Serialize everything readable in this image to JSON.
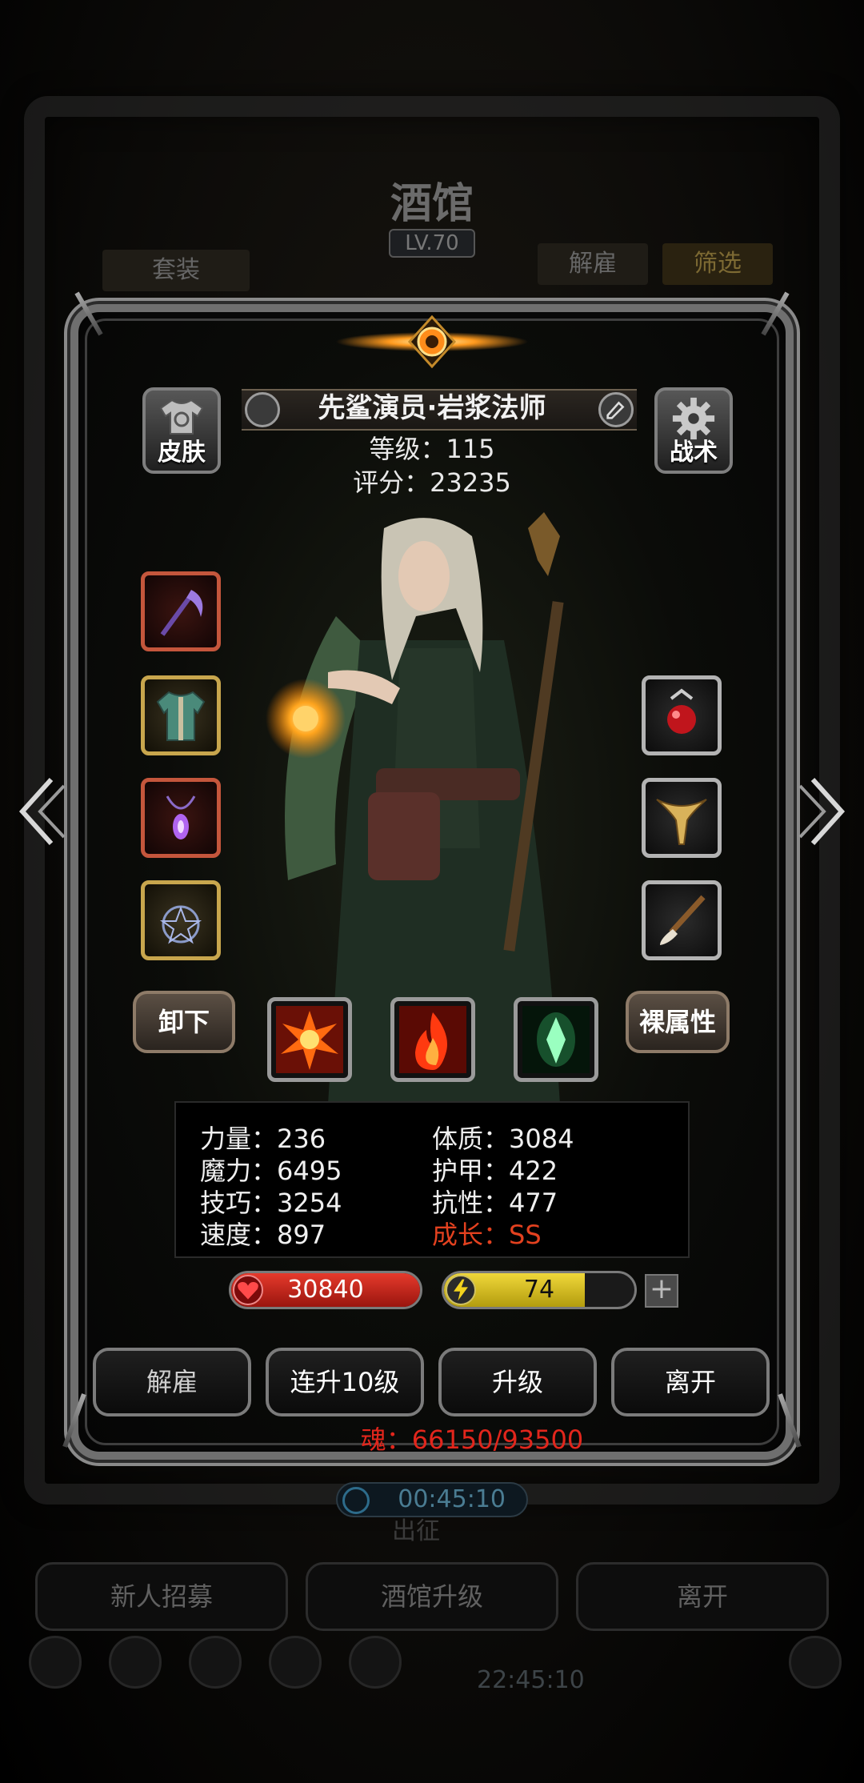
{
  "background": {
    "title": "酒馆",
    "level": "LV.70",
    "tab_suit": "套装",
    "tab_dismiss": "解雇",
    "tab_filter": "筛选",
    "timer": "00:45:10",
    "expedition_label": "出征",
    "bottom_buttons": [
      "新人招募",
      "酒馆升级",
      "离开"
    ],
    "clock": "22:45:10"
  },
  "hero": {
    "name": "先鲨演员·岩浆法师",
    "level_label": "等级：115",
    "score_label": "评分：23235",
    "skin_button": "皮肤",
    "tactics_button": "战术",
    "unequip_button": "卸下",
    "base_attr_button": "裸属性",
    "equipment_left": [
      "scythe-icon",
      "robe-icon",
      "amulet-icon",
      "pentagram-amulet-icon"
    ],
    "equipment_right": [
      "ruby-ring-icon",
      "horn-ring-icon",
      "brush-icon"
    ],
    "skills": [
      "fire-burst-skill-icon",
      "flame-skill-icon",
      "green-crystal-skill-icon"
    ]
  },
  "stats": {
    "strength": "力量：236",
    "constitution": "体质：3084",
    "magic": "魔力：6495",
    "armor": "护甲：422",
    "skill": "技巧：3254",
    "resistance": "抗性：477",
    "speed": "速度：897",
    "growth": "成长：SS"
  },
  "bars": {
    "hp": "30840",
    "energy": "74",
    "energy_fraction": 0.74
  },
  "actions": {
    "dismiss": "解雇",
    "upgrade10": "连升10级",
    "upgrade": "升级",
    "leave": "离开"
  },
  "soul": "魂：66150/93500",
  "colors": {
    "accent_red": "#e3411f",
    "hp_red": "#c0241d",
    "energy_yellow": "#d9c21e"
  }
}
